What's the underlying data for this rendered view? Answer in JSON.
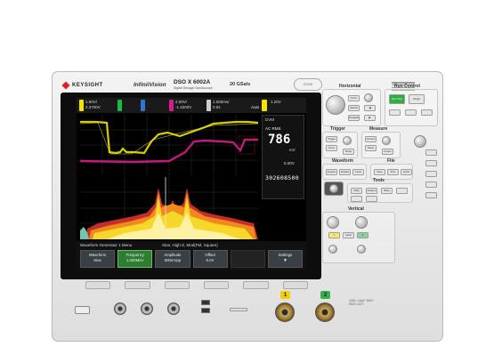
{
  "bezel": {
    "brand": "KEYSIGHT",
    "product_line": "InfiniiVision",
    "model": "DSO X 6002A",
    "model_sub": "Digital Storage Oscilloscope",
    "sample_rate": "20 GSa/s",
    "zone_badge": "ZONE"
  },
  "status_bar": {
    "ch1": {
      "scale": "1.50V/",
      "offset": "2.3700V",
      "color": "#f2e300"
    },
    "ch2": {
      "scale": "",
      "offset": "",
      "color": "#1db94a"
    },
    "ch3": {
      "scale": "",
      "offset": "",
      "color": "#2f74d0"
    },
    "ch4": {
      "scale": "2.00V/",
      "offset": "-1.4200V",
      "color": "#d61c8b"
    },
    "timebase": {
      "scale": "1.000ms/",
      "delay": "0.0s"
    },
    "trigger": {
      "mode": "Auto",
      "level": "1.20V"
    }
  },
  "dvm": {
    "title": "DVM",
    "mode": "AC RMS",
    "value": "786",
    "unit": "mV",
    "range": "5.00V",
    "frequency": "302608500"
  },
  "menu": {
    "title": "Waveform Generator 1 Menu",
    "info": "Sine, High-Z, Mod(FM, Square)",
    "softkeys": [
      {
        "label": "Waveform",
        "value": "Sine",
        "active": false
      },
      {
        "label": "Frequency",
        "value": "1.000MHz",
        "active": true
      },
      {
        "label": "Amplitude",
        "value": "500mVpp",
        "active": false
      },
      {
        "label": "Offset",
        "value": "0.0V",
        "active": false
      },
      {
        "label": "",
        "value": "",
        "active": false
      },
      {
        "label": "Settings",
        "value": "",
        "active": false
      }
    ]
  },
  "panel": {
    "horizontal_label": "Horizontal",
    "run_control_label": "Run Control",
    "trigger_label": "Trigger",
    "measure_label": "Measure",
    "waveform_label": "Waveform",
    "file_label": "File",
    "tools_label": "Tools",
    "vertical_label": "Vertical",
    "run_stop": "Run Stop",
    "single": "Single",
    "buttons_horizontal": [
      "Horiz",
      "Search",
      "Navigate"
    ],
    "buttons_trigger": [
      "Trigger",
      "Force",
      "Mode"
    ],
    "buttons_measure": [
      "Cursors",
      "Meas",
      "Cursor"
    ],
    "buttons_waveform": [
      "Acquire",
      "Display",
      "Label"
    ],
    "buttons_file": [
      "Save",
      "Print",
      "Quick"
    ],
    "buttons_tools": [
      "Utility",
      "Analyze",
      "Wave Gen"
    ],
    "buttons_vertical": [
      "1",
      "Label",
      "2"
    ],
    "run_color": "#2fae3e",
    "stop_color": "#d12a2a"
  },
  "front": {
    "ch1_num": "1",
    "ch2_num": "2",
    "ch1_color": "#f2d000",
    "ch2_color": "#36b24a",
    "probe_note": "1MΩ ≈14pF 300V RMS CAT I"
  }
}
